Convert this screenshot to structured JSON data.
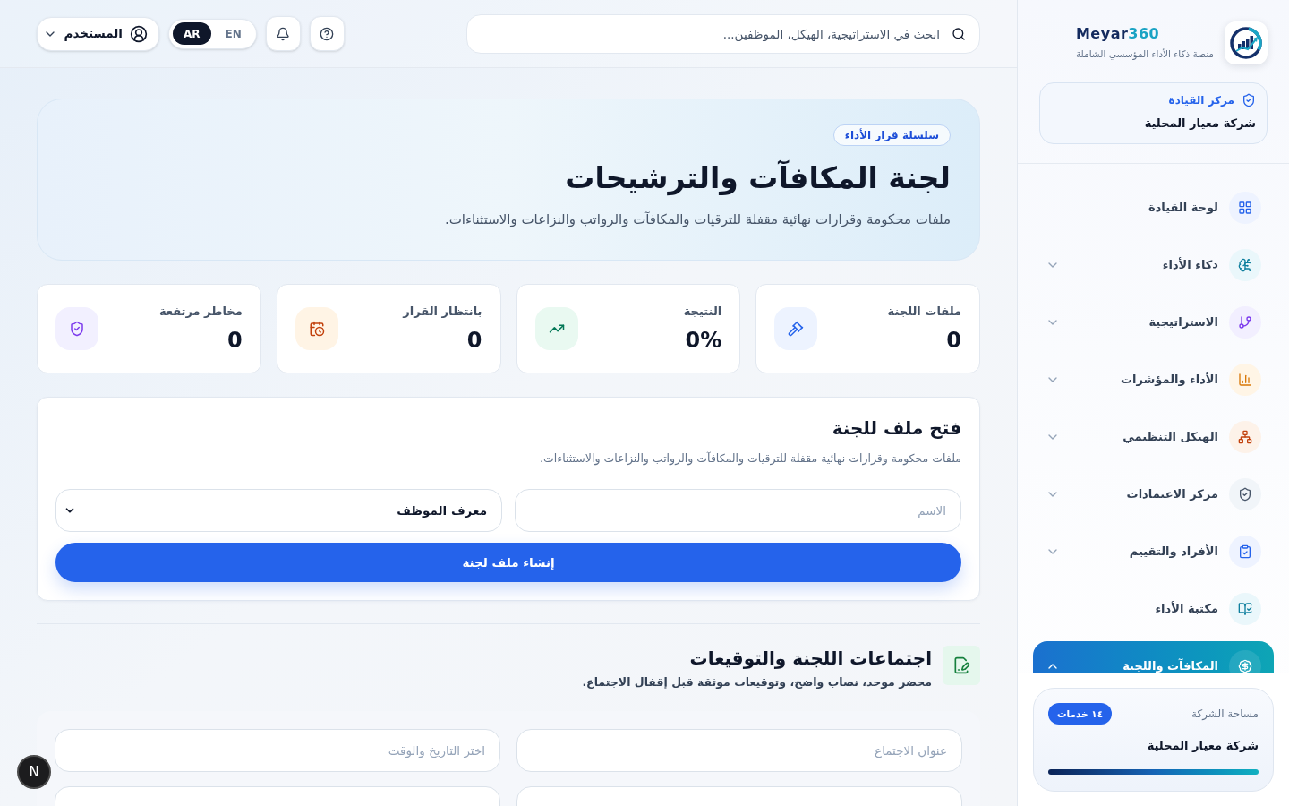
{
  "sidebar": {
    "brand": {
      "name": "Meyar",
      "name_accent": "360",
      "tagline": "منصة ذكاء الأداء المؤسسي الشاملة"
    },
    "context_card": {
      "label": "مركز القيادة",
      "company": "شركة معيار المحلية"
    },
    "nav": [
      {
        "label": "لوحة القيادة",
        "kind": "link",
        "selected": false
      },
      {
        "label": "ذكاء الأداء",
        "kind": "group",
        "expanded": false,
        "selected": false
      },
      {
        "label": "الاستراتيجية",
        "kind": "group",
        "expanded": false,
        "selected": false
      },
      {
        "label": "الأداء والمؤشرات",
        "kind": "group",
        "expanded": false,
        "selected": false
      },
      {
        "label": "الهيكل التنظيمي",
        "kind": "group",
        "expanded": false,
        "selected": false
      },
      {
        "label": "مركز الاعتمادات",
        "kind": "group",
        "expanded": false,
        "selected": false
      },
      {
        "label": "الأفراد والتقييم",
        "kind": "group",
        "expanded": false,
        "selected": false
      },
      {
        "label": "مكتبة الأداء",
        "kind": "link",
        "selected": false
      },
      {
        "label": "المكافآت واللجنة",
        "kind": "group",
        "expanded": true,
        "selected": true
      }
    ],
    "workspace": {
      "label": "مساحة الشركة",
      "badge": "١٤ خدمات",
      "company": "شركة معيار المحلية",
      "level": 1
    }
  },
  "top_bar": {
    "search": {
      "placeholder": "ابحث في الاستراتيجية، الهيكل، الموظفين..."
    },
    "languages": [
      {
        "label": "EN",
        "selected": false
      },
      {
        "label": "AR",
        "selected": true
      }
    ],
    "user": {
      "label": "المستخدم"
    }
  },
  "hero": {
    "tag": "سلسلة قرار الأداء",
    "title": "لجنة المكافآت والترشيحات",
    "subtitle": "ملفات محكومة وقرارات نهائية مقفلة للترقيات والمكافآت والرواتب والنزاعات والاستثناءات."
  },
  "stats": [
    {
      "label": "ملفات اللجنة",
      "value": "0"
    },
    {
      "label": "النتيجة",
      "value": "0%"
    },
    {
      "label": "بانتظار القرار",
      "value": "0"
    },
    {
      "label": "مخاطر مرتفعة",
      "value": "0"
    }
  ],
  "open_file_form": {
    "title": "فتح ملف للجنة",
    "description": "ملفات محكومة وقرارات نهائية مقفلة للترقيات والمكافآت والرواتب والنزاعات والاستثناءات.",
    "name_field": {
      "placeholder": "الاسم"
    },
    "employee_select": {
      "value": "معرف الموظف"
    },
    "submit": "إنشاء ملف لجنة"
  },
  "meetings": {
    "title": "اجتماعات اللجنة والتوقيعات",
    "subtitle": "محضر موحد، نصاب واضح، وتوقيعات موثقة قبل إقفال الاجتماع.",
    "fields": [
      {
        "kind": "input",
        "placeholder": "عنوان الاجتماع"
      },
      {
        "kind": "input",
        "placeholder": "اختر التاريخ والوقت"
      },
      {
        "kind": "input"
      },
      {
        "kind": "input"
      }
    ]
  },
  "dev_badge": "N"
}
